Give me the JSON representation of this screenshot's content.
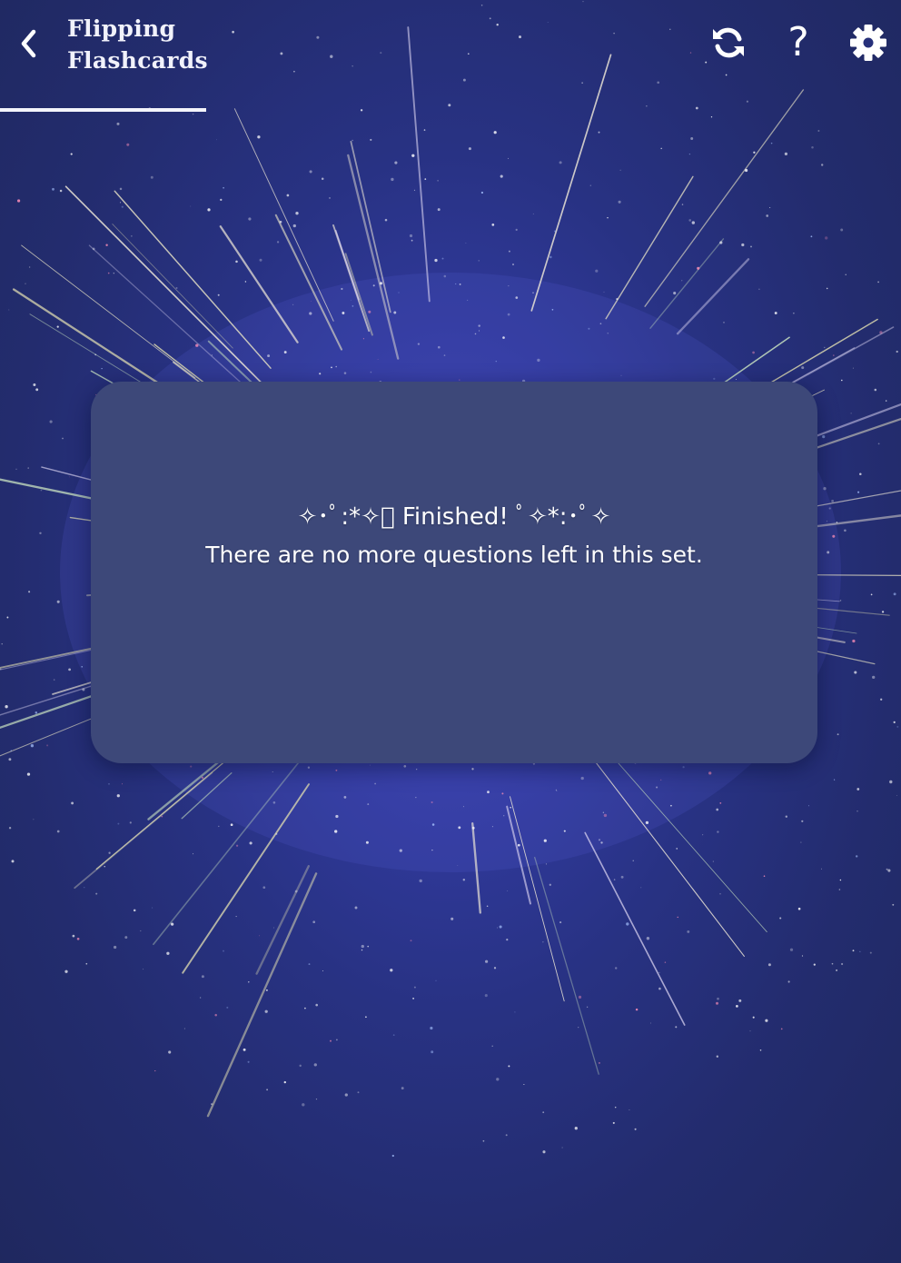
{
  "header": {
    "title_line1": "Flipping",
    "title_line2": "Flashcards",
    "back_icon": "chevron-left-icon",
    "actions": [
      {
        "name": "refresh",
        "icon": "refresh-icon"
      },
      {
        "name": "help",
        "icon": "help-icon",
        "glyph": "?"
      },
      {
        "name": "settings",
        "icon": "gear-icon"
      }
    ]
  },
  "card": {
    "heading": "✧･ﾟ:*✧ﾟ Finished! ﾟ✧*:･ﾟ✧",
    "message": "There are no more questions left in this set."
  },
  "colors": {
    "background_center": "#3f46b8",
    "background_edge": "#1f285f",
    "card": "#3d4879",
    "text": "#ffffff"
  }
}
